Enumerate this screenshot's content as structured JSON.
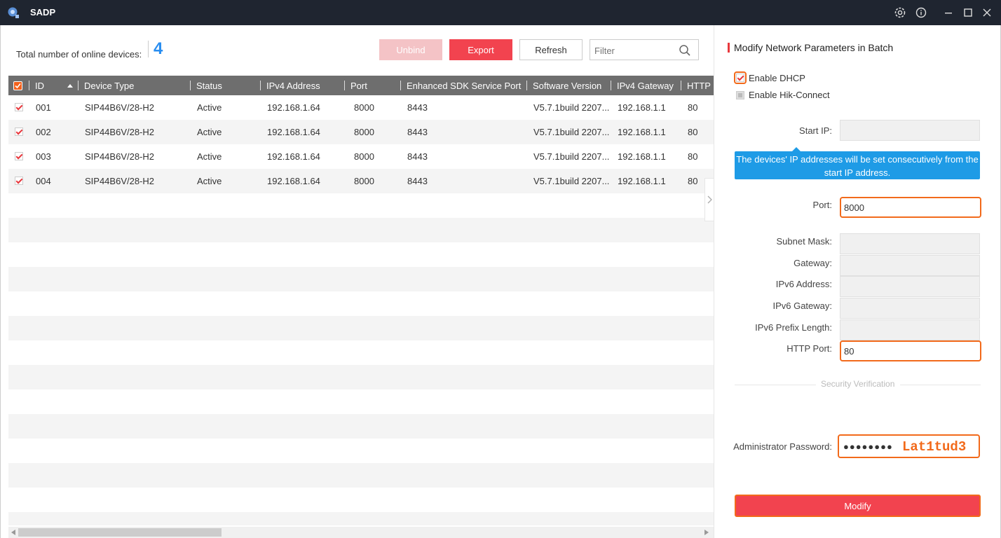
{
  "window": {
    "title": "SADP"
  },
  "toolbar": {
    "count_label": "Total number of online devices:",
    "count_value": "4",
    "unbind_label": "Unbind",
    "export_label": "Export",
    "refresh_label": "Refresh",
    "filter_placeholder": "Filter"
  },
  "table": {
    "columns": [
      "ID",
      "Device Type",
      "Status",
      "IPv4 Address",
      "Port",
      "Enhanced SDK Service Port",
      "Software Version",
      "IPv4 Gateway",
      "HTTP Port"
    ],
    "rows": [
      {
        "id": "001",
        "device_type": "SIP44B6V/28-H2",
        "status": "Active",
        "ipv4": "192.168.1.64",
        "port": "8000",
        "sdk_port": "8443",
        "version": "V5.7.1build 2207...",
        "gateway": "192.168.1.1",
        "http_port": "80"
      },
      {
        "id": "002",
        "device_type": "SIP44B6V/28-H2",
        "status": "Active",
        "ipv4": "192.168.1.64",
        "port": "8000",
        "sdk_port": "8443",
        "version": "V5.7.1build 2207...",
        "gateway": "192.168.1.1",
        "http_port": "80"
      },
      {
        "id": "003",
        "device_type": "SIP44B6V/28-H2",
        "status": "Active",
        "ipv4": "192.168.1.64",
        "port": "8000",
        "sdk_port": "8443",
        "version": "V5.7.1build 2207...",
        "gateway": "192.168.1.1",
        "http_port": "80"
      },
      {
        "id": "004",
        "device_type": "SIP44B6V/28-H2",
        "status": "Active",
        "ipv4": "192.168.1.64",
        "port": "8000",
        "sdk_port": "8443",
        "version": "V5.7.1build 2207...",
        "gateway": "192.168.1.1",
        "http_port": "80"
      }
    ]
  },
  "panel": {
    "title": "Modify Network Parameters in Batch",
    "enable_dhcp": "Enable DHCP",
    "enable_hik": "Enable Hik-Connect",
    "start_ip_label": "Start IP:",
    "tooltip": "The devices' IP addresses will be set consecutively from the start IP address.",
    "port_label": "Port:",
    "port_value": "8000",
    "subnet_label": "Subnet Mask:",
    "gateway_label": "Gateway:",
    "ipv6_label": "IPv6 Address:",
    "ipv6_gateway_label": "IPv6 Gateway:",
    "ipv6_prefix_label": "IPv6 Prefix Length:",
    "http_port_label": "HTTP Port:",
    "http_port_value": "80",
    "security_label": "Security Verification",
    "admin_pw_label": "Administrator Password:",
    "admin_pw_dots": "●●●●●●●●",
    "admin_pw_hint": "Lat1tud3",
    "modify_label": "Modify"
  },
  "colors": {
    "accent": "#f2434f",
    "highlight": "#f26a1b",
    "count": "#2a8ef0",
    "tooltip": "#1e9be6",
    "titlebar": "#1f2530"
  }
}
